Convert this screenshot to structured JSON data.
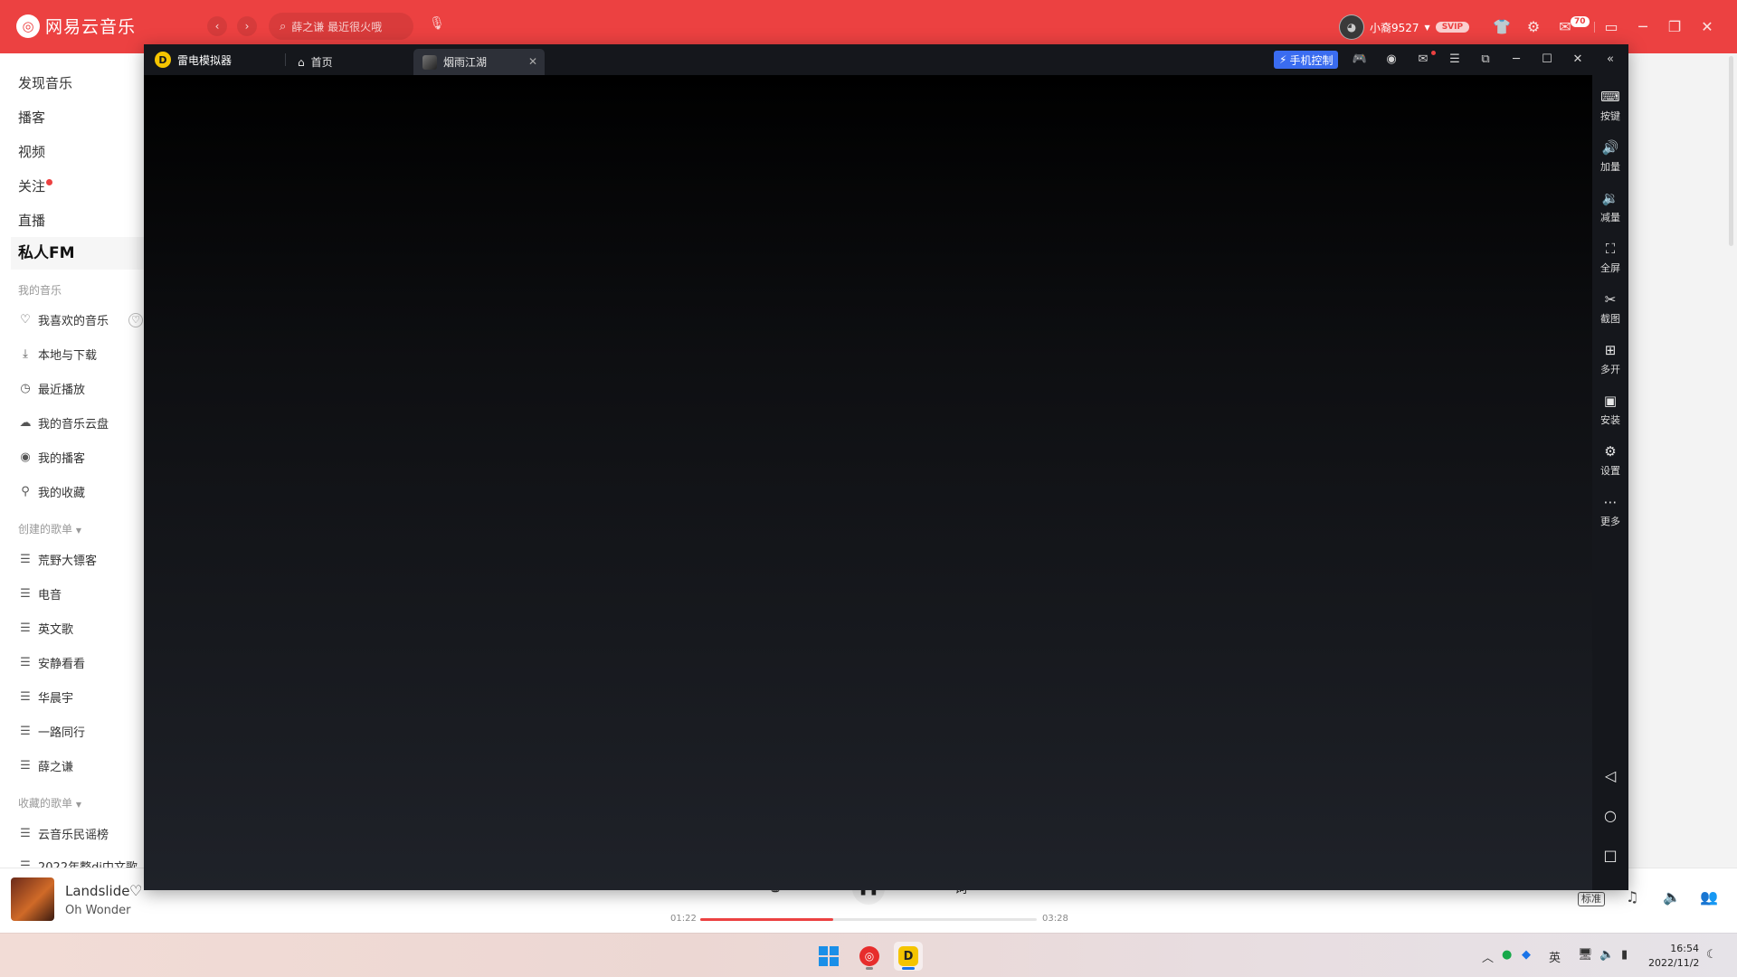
{
  "app": {
    "logo_text": "网易云音乐",
    "search_placeholder": "薛之谦 最近很火哦",
    "user_name": "小裔9527",
    "vip_label": "SVIP",
    "mail_count": "70"
  },
  "sidebar": {
    "main_items": [
      {
        "label": "发现音乐"
      },
      {
        "label": "播客"
      },
      {
        "label": "视频"
      },
      {
        "label": "关注",
        "has_dot": true
      },
      {
        "label": "直播"
      },
      {
        "label": "私人FM",
        "active": true
      }
    ],
    "my_music_title": "我的音乐",
    "my_music": [
      {
        "label": "我喜欢的音乐",
        "icon": "heart-icon"
      },
      {
        "label": "本地与下载",
        "icon": "download-icon"
      },
      {
        "label": "最近播放",
        "icon": "clock-icon"
      },
      {
        "label": "我的音乐云盘",
        "icon": "cloud-icon"
      },
      {
        "label": "我的播客",
        "icon": "podcast-icon"
      },
      {
        "label": "我的收藏",
        "icon": "collection-icon"
      }
    ],
    "created_title": "创建的歌单",
    "created": [
      {
        "label": "荒野大镖客"
      },
      {
        "label": "电音"
      },
      {
        "label": "英文歌"
      },
      {
        "label": "安静看看"
      },
      {
        "label": "华晨宇"
      },
      {
        "label": "一路同行"
      },
      {
        "label": "薛之谦"
      }
    ],
    "collected_title": "收藏的歌单",
    "collected": [
      {
        "label": "云音乐民谣榜"
      },
      {
        "label": "2022年整dj中文歌"
      }
    ]
  },
  "player": {
    "song_title": "Landslide",
    "artist": "Oh Wonder",
    "current_time": "01:22",
    "total_time": "03:28",
    "progress": 0.394,
    "quality": "标准",
    "is_playing": true
  },
  "emulator": {
    "brand": "雷电模拟器",
    "tabs": [
      {
        "label": "首页"
      },
      {
        "label": "烟雨江湖",
        "active": true
      }
    ],
    "phone_control_label": "手机控制",
    "tools": [
      {
        "label": "按键",
        "icon": "keyboard-icon"
      },
      {
        "label": "加量",
        "icon": "volume-up-icon"
      },
      {
        "label": "减量",
        "icon": "volume-down-icon"
      },
      {
        "label": "全屏",
        "icon": "fullscreen-icon"
      },
      {
        "label": "截图",
        "icon": "scissors-icon"
      },
      {
        "label": "多开",
        "icon": "multi-instance-icon"
      },
      {
        "label": "安装",
        "icon": "apk-install-icon"
      },
      {
        "label": "设置",
        "icon": "settings-icon"
      },
      {
        "label": "更多",
        "icon": "more-icon"
      }
    ]
  },
  "taskbar": {
    "ime": "英",
    "time": "16:54",
    "date": "2022/11/2"
  },
  "colors": {
    "netease_red": "#ec4141",
    "emulator_dark": "#15171c",
    "phone_ctrl_blue": "#3a6cf0",
    "ld_yellow": "#f5c400"
  }
}
